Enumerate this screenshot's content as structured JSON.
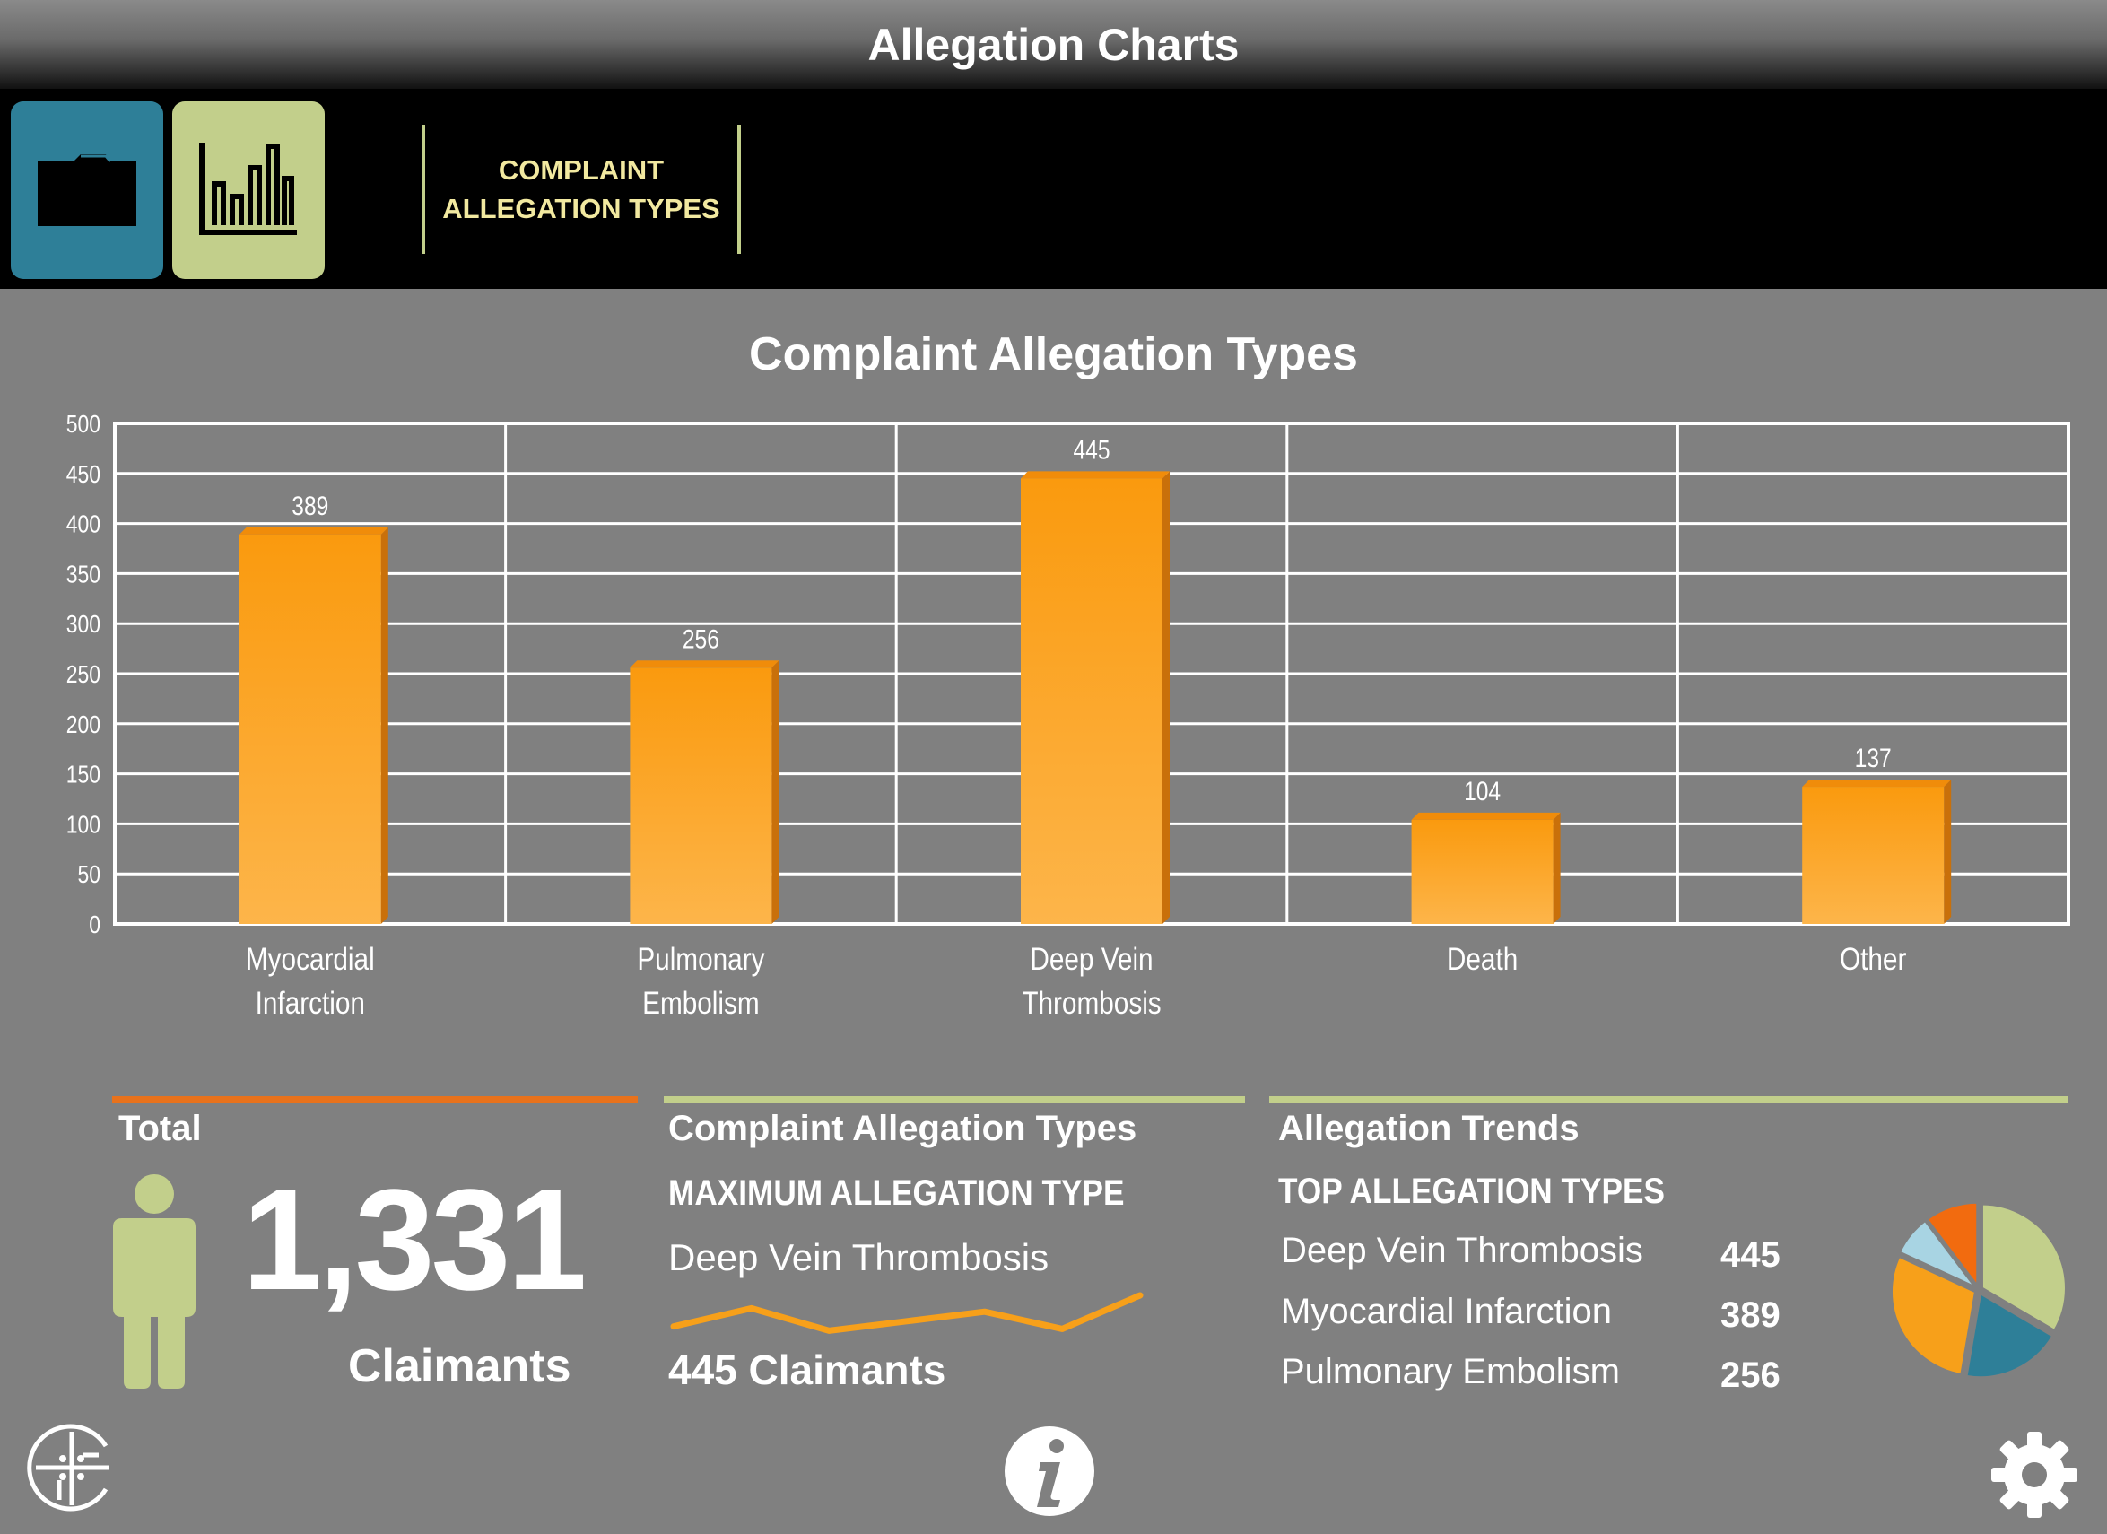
{
  "window": {
    "title": "Allegation Charts"
  },
  "toolbar": {
    "folder_icon": "folder-icon",
    "chart_icon": "bar-chart-icon",
    "tab_line1": "COMPLAINT",
    "tab_line2": "ALLEGATION TYPES"
  },
  "chart_data": {
    "type": "bar",
    "title": "Complaint Allegation Types",
    "categories": [
      "Myocardial Infarction",
      "Pulmonary Embolism",
      "Deep Vein Thrombosis",
      "Death",
      "Other"
    ],
    "category_lines": [
      [
        "Myocardial",
        "Infarction"
      ],
      [
        "Pulmonary",
        "Embolism"
      ],
      [
        "Deep Vein",
        "Thrombosis"
      ],
      [
        "Death"
      ],
      [
        "Other"
      ]
    ],
    "values": [
      389,
      256,
      445,
      104,
      137
    ],
    "ylim": [
      0,
      500
    ],
    "yticks": [
      0,
      50,
      100,
      150,
      200,
      250,
      300,
      350,
      400,
      450,
      500
    ],
    "grid": true,
    "bar_color": "#f7a01a"
  },
  "total_panel": {
    "heading": "Total",
    "value": "1,331",
    "label": "Claimants",
    "accent": "#e8721c",
    "figure_color": "#c2cf8b",
    "icon": "person-icon"
  },
  "types_panel": {
    "heading": "Complaint Allegation Types",
    "subheading": "MAXIMUM ALLEGATION TYPE",
    "max_type": "Deep Vein Thrombosis",
    "claimants": "445 Claimants",
    "accent": "#c2cf8b",
    "sparkline": [
      0.72,
      0.3,
      0.82,
      0.6,
      0.38,
      0.78,
      0.0
    ]
  },
  "trends_panel": {
    "heading": "Allegation Trends",
    "subheading": "TOP ALLEGATION TYPES",
    "rows": [
      {
        "label": "Deep Vein Thrombosis",
        "value": "445"
      },
      {
        "label": "Myocardial Infarction",
        "value": "389"
      },
      {
        "label": "Pulmonary Embolism",
        "value": "256"
      }
    ],
    "accent": "#c2cf8b",
    "pie": {
      "slices": [
        {
          "value": 445,
          "color": "#c2cf8b"
        },
        {
          "value": 256,
          "color": "#2e7f98"
        },
        {
          "value": 389,
          "color": "#f7a01a"
        },
        {
          "value": 104,
          "color": "#a8d4e3"
        },
        {
          "value": 137,
          "color": "#f26b0f"
        }
      ]
    }
  },
  "footer": {
    "logo_icon": "crosshair-logo-icon",
    "info_icon": "info-icon",
    "settings_icon": "gear-icon"
  }
}
